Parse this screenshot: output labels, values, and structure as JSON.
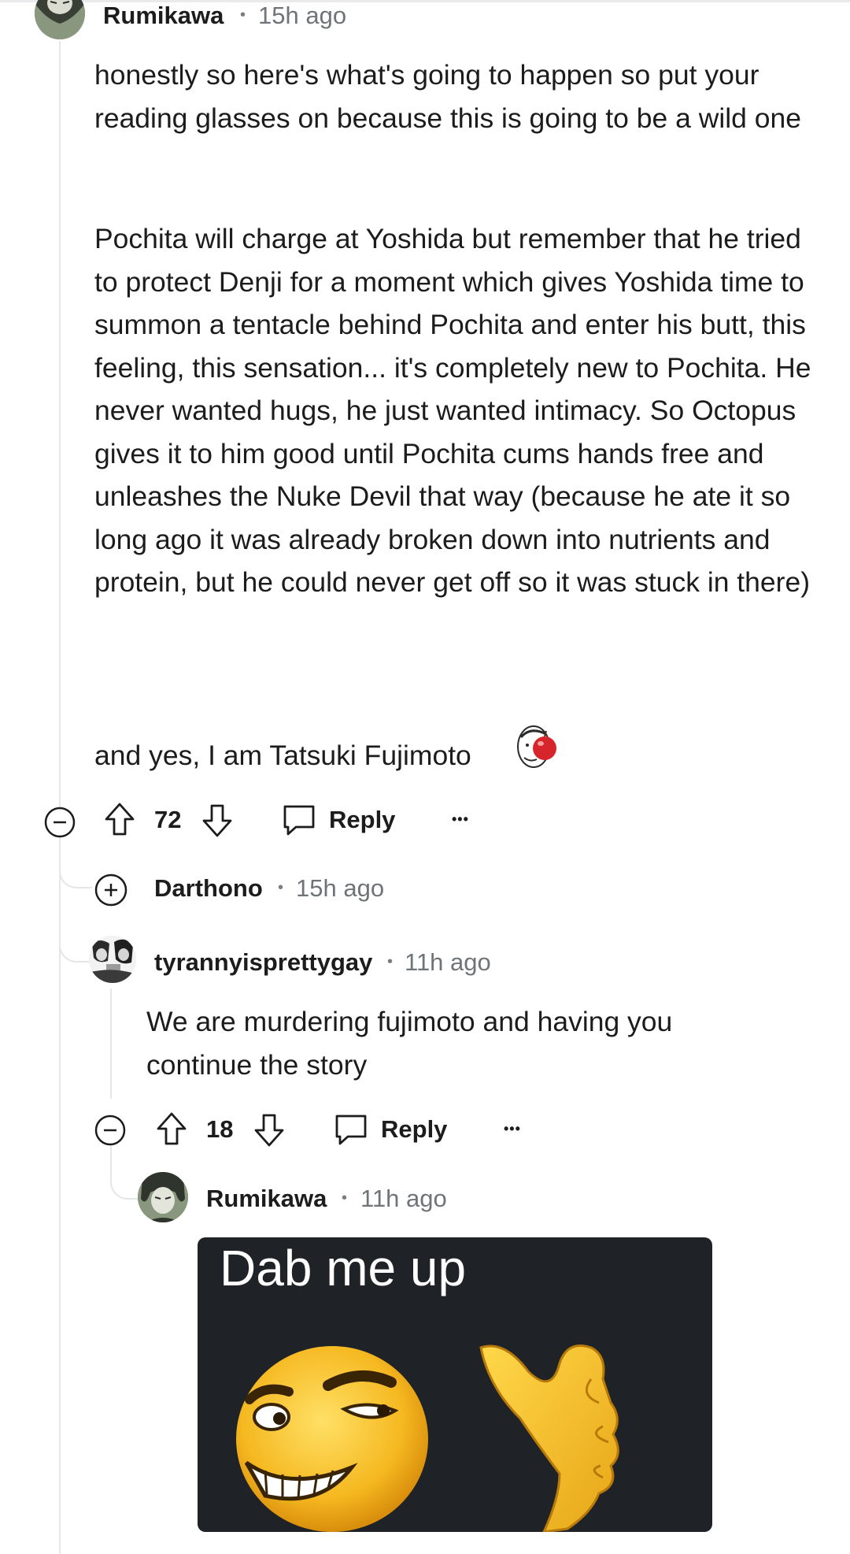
{
  "comments": [
    {
      "username": "Rumikawa",
      "time": "15h ago",
      "paragraphs": [
        "honestly so here's what's going to happen so put your reading glasses on because this is going to be a wild one",
        "Pochita will charge at Yoshida but remember that he tried to protect Denji for a moment which gives Yoshida time to summon a tentacle behind Pochita and enter his butt, this feeling, this sensation... it's completely new to Pochita. He never wanted hugs, he just wanted intimacy. So Octopus gives it to him good until Pochita cums hands free and unleashes the Nuke Devil that way (because he ate it so long ago it was already broken down into nutrients and protein, but he could never get off so it was stuck in there)",
        "and yes, I am Tatsuki Fujimoto"
      ],
      "votes": "72",
      "reply_label": "Reply",
      "more_label": "•••"
    },
    {
      "username": "Darthono",
      "time": "15h ago",
      "collapsed": true
    },
    {
      "username": "tyrannyisprettygay",
      "time": "11h ago",
      "paragraphs": [
        "We are murdering fujimoto and having you continue the story"
      ],
      "votes": "18",
      "reply_label": "Reply",
      "more_label": "•••"
    },
    {
      "username": "Rumikawa",
      "time": "11h ago",
      "image_caption": "Dab me up"
    }
  ],
  "separator": "•",
  "icons": {
    "collapse": "collapse-minus-icon",
    "expand": "expand-plus-icon",
    "upvote": "upvote-arrow-icon",
    "downvote": "downvote-arrow-icon",
    "reply": "speech-bubble-icon"
  },
  "colors": {
    "text": "#1c1c1c",
    "meta": "#6f7478",
    "thread_line": "#e4e6e8"
  }
}
